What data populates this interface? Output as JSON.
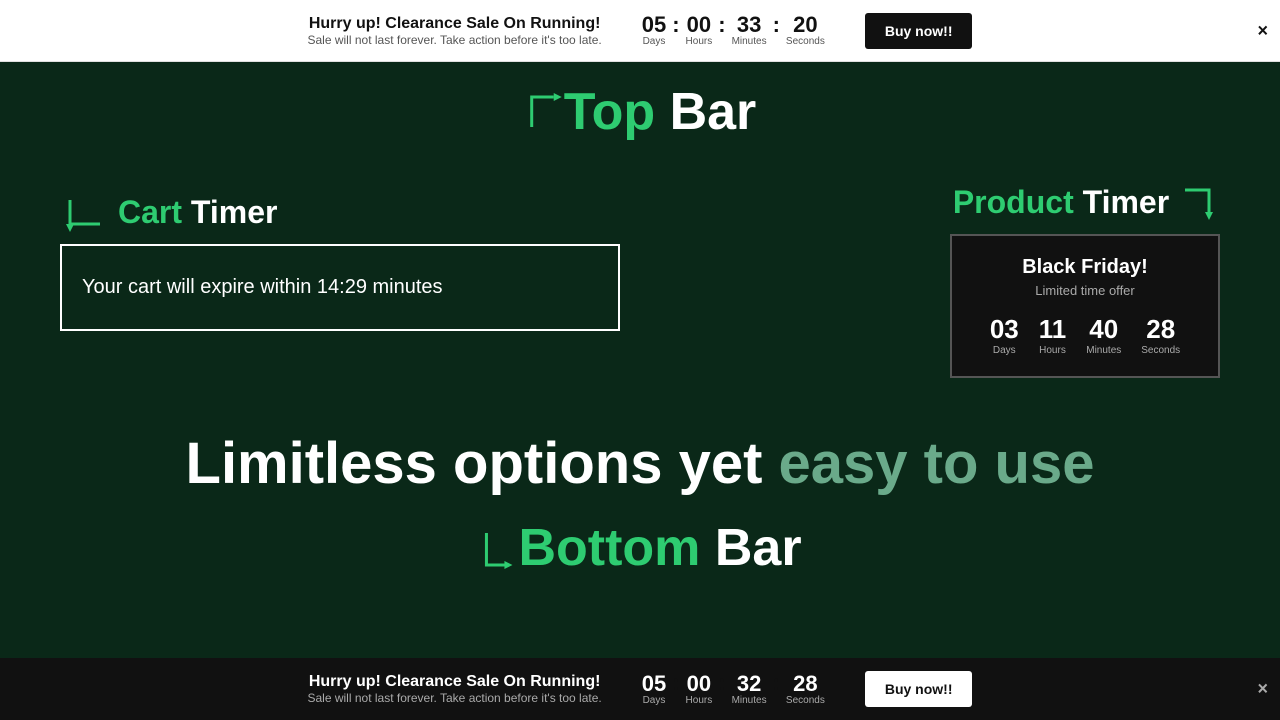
{
  "topBar": {
    "headline": "Hurry up! Clearance Sale On Running!",
    "subtext": "Sale will not last forever. Take action before it's too late.",
    "countdown": {
      "days": {
        "value": "05",
        "label": "Days"
      },
      "hours": {
        "value": "00",
        "label": "Hours"
      },
      "minutes": {
        "value": "33",
        "label": "Minutes"
      },
      "seconds": {
        "value": "20",
        "label": "Seconds"
      }
    },
    "buyButton": "Buy now!!",
    "closeIcon": "×"
  },
  "topBarLabel": {
    "greenText": "Top",
    "whiteText": " Bar"
  },
  "cartTimer": {
    "labelGreen": "Cart",
    "labelWhite": " Timer",
    "boxText": "Your cart  will expire within 14:29 minutes"
  },
  "productTimer": {
    "labelGreen": "Product",
    "labelWhite": " Timer",
    "boxTitle": "Black Friday!",
    "boxSubtitle": "Limited time offer",
    "countdown": {
      "days": {
        "value": "03",
        "label": "Days"
      },
      "hours": {
        "value": "11",
        "label": "Hours"
      },
      "minutes": {
        "value": "40",
        "label": "Minutes"
      },
      "seconds": {
        "value": "28",
        "label": "Seconds"
      }
    }
  },
  "limitlessText": {
    "part1": "Limitless options yet ",
    "part2": "easy to use"
  },
  "bottomBarLabel": {
    "greenText": "Bottom",
    "whiteText": " Bar"
  },
  "bottomBar": {
    "headline": "Hurry up! Clearance Sale On Running!",
    "subtext": "Sale will not last forever. Take action before it's too late.",
    "countdown": {
      "days": {
        "value": "05",
        "label": "Days"
      },
      "hours": {
        "value": "00",
        "label": "Hours"
      },
      "minutes": {
        "value": "32",
        "label": "Minutes"
      },
      "seconds": {
        "value": "28",
        "label": "Seconds"
      }
    },
    "buyButton": "Buy now!!",
    "closeIcon": "×"
  }
}
